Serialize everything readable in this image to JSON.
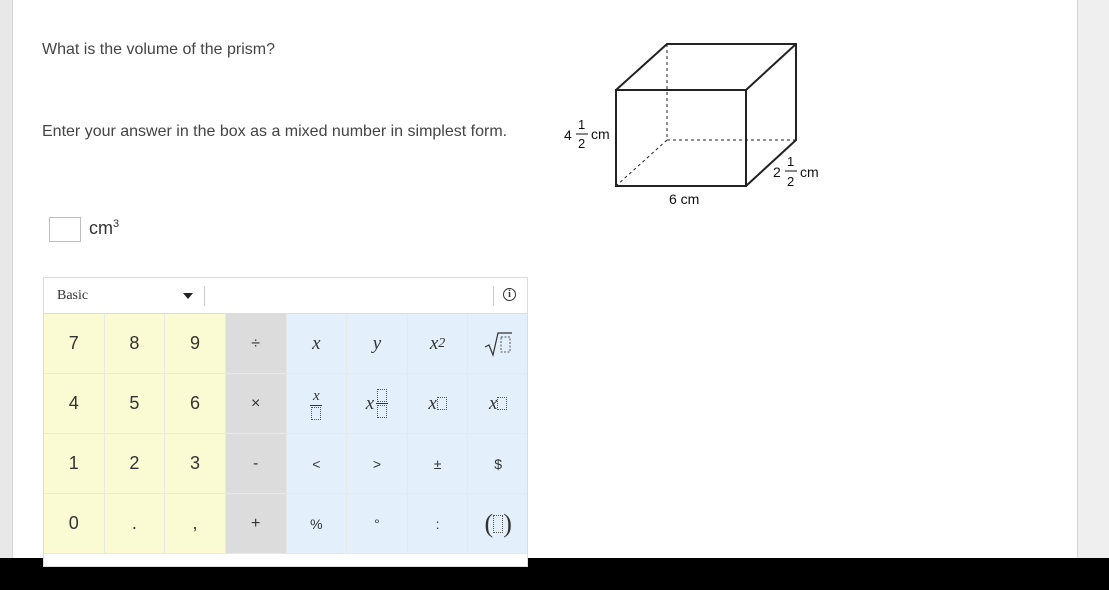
{
  "question": {
    "prompt": "What is the volume of the prism?",
    "instruction": "Enter your answer in the box as a mixed number in simplest form.",
    "answer_value": "",
    "answer_unit": "cm",
    "answer_unit_exp": "3"
  },
  "figure": {
    "height_whole": "4",
    "height_num": "1",
    "height_den": "2",
    "height_unit": "cm",
    "depth_whole": "2",
    "depth_num": "1",
    "depth_den": "2",
    "depth_unit": "cm",
    "width_label": "6 cm"
  },
  "calculator": {
    "mode": "Basic",
    "keys": {
      "k7": "7",
      "k8": "8",
      "k9": "9",
      "divide": "÷",
      "x": "x",
      "y": "y",
      "x2_base": "x",
      "x2_exp": "2",
      "k4": "4",
      "k5": "5",
      "k6": "6",
      "times": "×",
      "xfrac_top": "x",
      "mixed_x": "x",
      "power_base": "x",
      "sub_base": "x",
      "k1": "1",
      "k2": "2",
      "k3": "3",
      "minus": "-",
      "lt": "<",
      "gt": ">",
      "pm": "±",
      "dollar": "$",
      "k0": "0",
      "dot": ".",
      "comma": ",",
      "plus": "+",
      "percent": "%",
      "degree": "°",
      "colon": ":",
      "paren_l": "(",
      "paren_r": ")"
    }
  }
}
